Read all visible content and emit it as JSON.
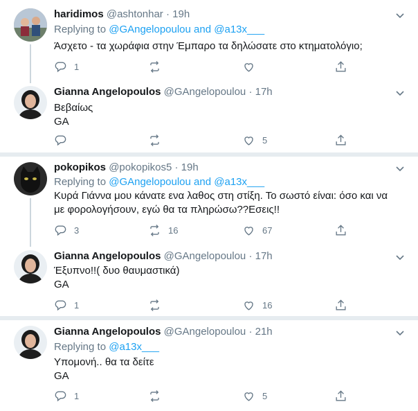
{
  "tweets": [
    {
      "name": "haridimos",
      "handle": "@ashtonhar",
      "time": "19h",
      "replying_label": "Replying to",
      "replying_to": [
        "@GAngelopoulou",
        "@a13x___"
      ],
      "replying_and": "and",
      "lines": [
        "Άσχετο - τα χωράφια στην Έμπαρο τα δηλώσατε στο κτηματολόγιο;"
      ],
      "counts": {
        "reply": "1",
        "retweet": "",
        "like": ""
      }
    },
    {
      "name": "Gianna Angelopoulos",
      "handle": "@GAngelopoulou",
      "time": "17h",
      "lines": [
        "Βεβαίως",
        "GA"
      ],
      "counts": {
        "reply": "",
        "retweet": "",
        "like": "5"
      }
    },
    {
      "name": "pokopikos",
      "handle": "@pokopikos5",
      "time": "19h",
      "replying_label": "Replying to",
      "replying_to": [
        "@GAngelopoulou",
        "@a13x___"
      ],
      "replying_and": "and",
      "lines": [
        "Κυρά Γιάννα μου κάνατε ενα λαθος στη στίξη. Το σωστό είναι: όσο και να",
        "με φορολογήσουν, εγώ θα τα πληρώσω??Εσεις!!"
      ],
      "counts": {
        "reply": "3",
        "retweet": "16",
        "like": "67"
      }
    },
    {
      "name": "Gianna Angelopoulos",
      "handle": "@GAngelopoulou",
      "time": "17h",
      "lines": [
        "Έξυπνο!!( δυο θαυμαστικά)",
        "GA"
      ],
      "counts": {
        "reply": "1",
        "retweet": "",
        "like": "16"
      }
    },
    {
      "name": "Gianna Angelopoulos",
      "handle": "@GAngelopoulou",
      "time": "21h",
      "replying_label": "Replying to",
      "replying_to": [
        "@a13x___"
      ],
      "lines": [
        "Υπομονή.. θα τα δείτε",
        "GA"
      ],
      "counts": {
        "reply": "1",
        "retweet": "",
        "like": "5"
      }
    }
  ],
  "colors": {
    "link": "#1da1f2",
    "muted": "#657786",
    "text": "#14171a",
    "divider": "#e6ecf0"
  },
  "icons": [
    "reply-icon",
    "retweet-icon",
    "like-icon",
    "share-icon",
    "chevron-down-icon"
  ]
}
